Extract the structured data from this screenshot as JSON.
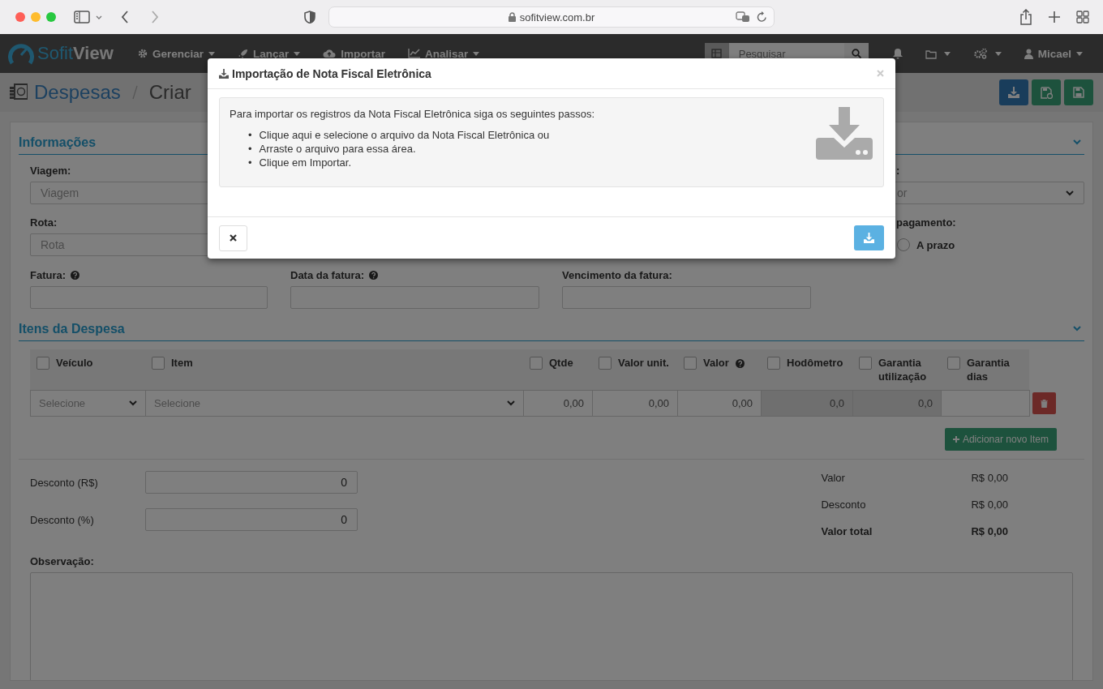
{
  "browser": {
    "url": "sofitview.com.br"
  },
  "navbar": {
    "brand_light": "Sofit",
    "brand_bold": "View",
    "menus": [
      {
        "label": "Gerenciar",
        "caret": true
      },
      {
        "label": "Lançar",
        "caret": true
      },
      {
        "label": "Importar",
        "caret": false
      },
      {
        "label": "Analisar",
        "caret": true
      }
    ],
    "search": {
      "placeholder": "Pesquisar"
    },
    "tools": [
      {
        "caret": false
      },
      {
        "caret": true
      },
      {
        "caret": true
      }
    ],
    "user": {
      "name": "Micael",
      "caret": true
    }
  },
  "page_header": {
    "title": "Despesas",
    "subtitle": "Criar"
  },
  "informacoes": {
    "title": "Informações",
    "expanded": true,
    "viagem": {
      "label": "Viagem:",
      "placeholder": "Viagem"
    },
    "rota": {
      "label": "Rota:",
      "placeholder": "Rota"
    },
    "right_select": {
      "label": ":",
      "placeholder": "or"
    },
    "payment": {
      "label": "pagamento:",
      "options": [
        {
          "label": "A prazo",
          "selected": false
        }
      ]
    },
    "invoice_fields": [
      {
        "label": "Fatura:",
        "help": true
      },
      {
        "label": "Data da fatura:",
        "help": true
      },
      {
        "label": "Vencimento da fatura:",
        "help": false
      }
    ]
  },
  "itens": {
    "title": "Itens da Despesa",
    "expanded": true,
    "columns": [
      {
        "label": "Veículo",
        "checked": false,
        "help": false
      },
      {
        "label": "Item",
        "checked": false,
        "help": false
      },
      {
        "label": "Qtde",
        "checked": false,
        "help": false
      },
      {
        "label": "Valor unit.",
        "checked": false,
        "help": false
      },
      {
        "label": "Valor",
        "checked": false,
        "help": true
      },
      {
        "label": "Hodômetro",
        "checked": false,
        "help": false
      },
      {
        "label": "Garantia utilização",
        "checked": false,
        "help": false
      },
      {
        "label": "Garantia dias",
        "checked": false,
        "help": false
      }
    ],
    "rows": [
      {
        "cells": [
          {
            "kind": "select",
            "placeholder": "Selecione"
          },
          {
            "kind": "select",
            "placeholder": "Selecione"
          },
          {
            "kind": "input",
            "value": "0,00"
          },
          {
            "kind": "input",
            "value": "0,00"
          },
          {
            "kind": "input",
            "value": "0,00"
          },
          {
            "kind": "readonly",
            "value": "0,0"
          },
          {
            "kind": "readonly",
            "value": "0,0"
          },
          {
            "kind": "input"
          }
        ]
      }
    ],
    "add_button": "Adicionar novo Item"
  },
  "discounts": [
    {
      "label": "Desconto (R$)",
      "value": "0"
    },
    {
      "label": "Desconto (%)",
      "value": "0"
    }
  ],
  "summary": [
    {
      "label": "Valor",
      "value": "R$ 0,00",
      "bold": false
    },
    {
      "label": "Desconto",
      "value": "R$ 0,00",
      "bold": false
    },
    {
      "label": "Valor total",
      "value": "R$ 0,00",
      "bold": true
    }
  ],
  "observacao": {
    "label": "Observação:"
  },
  "modal": {
    "title": "Importação de Nota Fiscal Eletrônica",
    "intro": "Para importar os registros da Nota Fiscal Eletrônica siga os seguintes passos:",
    "bullet": "•",
    "steps": [
      "Clique aqui e selecione o arquivo da Nota Fiscal Eletrônica ou",
      "Arraste o arquivo para essa área.",
      "Clique em Importar."
    ]
  }
}
